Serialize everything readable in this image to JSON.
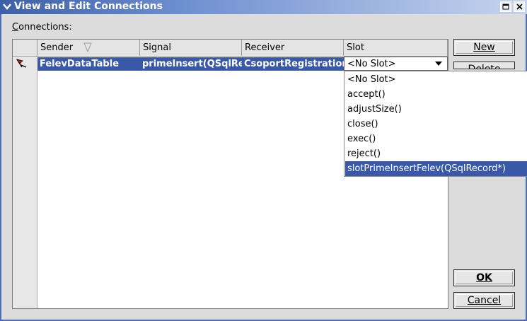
{
  "window": {
    "title": "View and Edit Connections",
    "menu_icon": "chevron-down-icon",
    "maximize_icon": "maximize-icon",
    "close_icon": "close-icon"
  },
  "connections_label": {
    "accel": "C",
    "rest": "onnections:"
  },
  "table": {
    "columns": [
      "Sender",
      "Signal",
      "Receiver",
      "Slot"
    ],
    "rows": [
      {
        "sender": "FelevDataTable",
        "signal": "primeInsert(QSqlRe",
        "receiver": "CsoportRegistratior",
        "slot": "<No Slot>",
        "row_icon": "connection-arrow-icon"
      }
    ]
  },
  "slot_dropdown": {
    "selected_index": 6,
    "options": [
      "<No Slot>",
      "accept()",
      "adjustSize()",
      "close()",
      "exec()",
      "reject()",
      "slotPrimeInsertFelev(QSqlRecord*)"
    ]
  },
  "buttons": {
    "new": "New",
    "delete": "Delete",
    "ok": "OK",
    "cancel": "Cancel"
  },
  "colors": {
    "selection": "#3a58a8",
    "title_gradient_start": "#3c5fa6"
  }
}
